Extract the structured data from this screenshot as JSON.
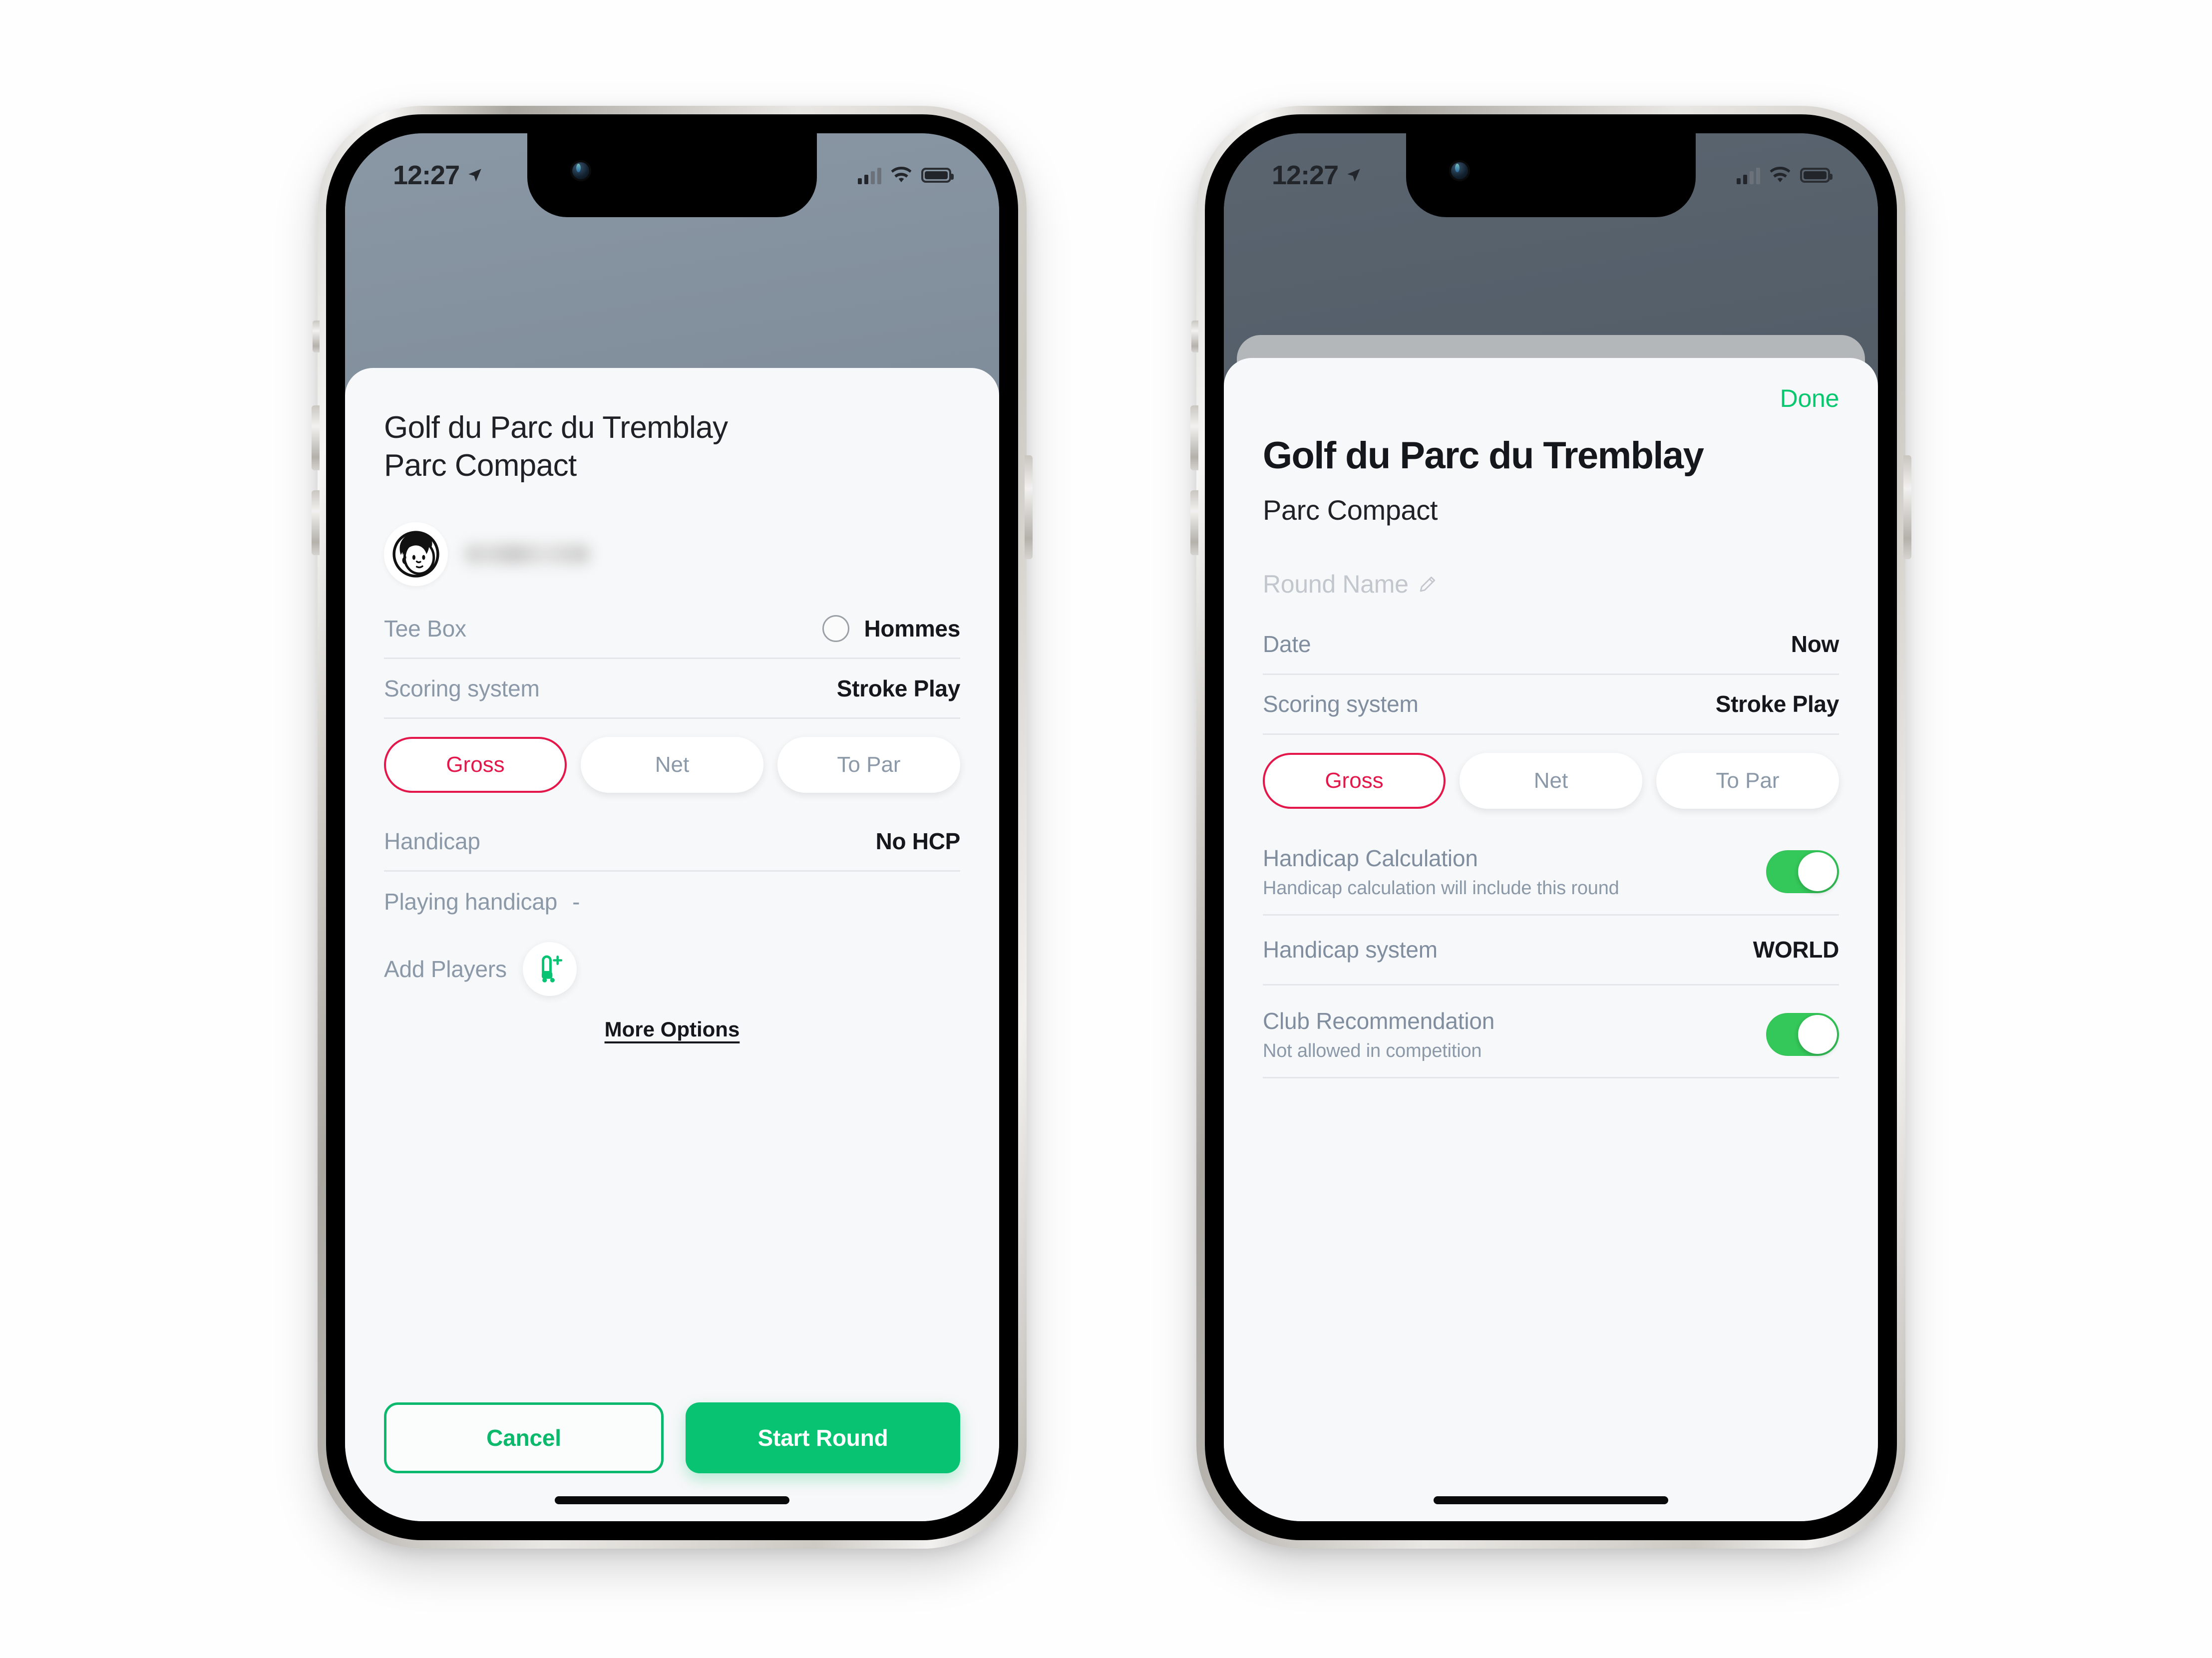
{
  "canvas": {
    "background": "#ffffff"
  },
  "theme": {
    "green": "#07c372",
    "green_link": "#07c86f",
    "toggle_green": "#34c759",
    "accent_red": "#e4174b",
    "label_gray": "#8b98a8",
    "value_dark": "#14181c",
    "sheet_bg": "#f7f8f9",
    "backdrop_left": "#7e8b99",
    "backdrop_right": "#515b66"
  },
  "status_bar": {
    "time": "12:27",
    "location_icon": "location-arrow-icon",
    "signal_icon": "cellular-signal-icon",
    "wifi_icon": "wifi-icon",
    "battery_icon": "battery-icon"
  },
  "left_phone": {
    "name": "start-round-sheet",
    "title": "Golf du Parc du Tremblay\nParc Compact",
    "title_line1": "Golf du Parc du Tremblay",
    "title_line2": "Parc Compact",
    "player": {
      "avatar_icon": "player-avatar-icon",
      "name_redacted": ""
    },
    "rows": [
      {
        "label": "Tee Box",
        "value": "Hommes",
        "has_swatch": true
      },
      {
        "label": "Scoring system",
        "value": "Stroke Play",
        "has_swatch": false
      }
    ],
    "segments": [
      {
        "label": "Gross",
        "active": true
      },
      {
        "label": "Net",
        "active": false
      },
      {
        "label": "To Par",
        "active": false
      }
    ],
    "handicap": {
      "label": "Handicap",
      "value": "No HCP"
    },
    "playing_handicap": {
      "label": "Playing handicap",
      "value": "-"
    },
    "add_players": {
      "label": "Add Players",
      "icon": "add-player-golf-bag-icon"
    },
    "more_options": "More Options",
    "actions": {
      "cancel": "Cancel",
      "start": "Start Round"
    }
  },
  "right_phone": {
    "name": "round-options-sheet",
    "done": "Done",
    "title": "Golf du Parc du Tremblay",
    "subtitle": "Parc Compact",
    "round_name": {
      "placeholder": "Round Name",
      "icon": "pencil-icon"
    },
    "rows": [
      {
        "label": "Date",
        "value": "Now"
      },
      {
        "label": "Scoring system",
        "value": "Stroke Play"
      }
    ],
    "segments": [
      {
        "label": "Gross",
        "active": true
      },
      {
        "label": "Net",
        "active": false
      },
      {
        "label": "To Par",
        "active": false
      }
    ],
    "toggles": [
      {
        "title": "Handicap Calculation",
        "subtitle": "Handicap calculation will include this round",
        "on": true
      },
      {
        "title": "Club Recommendation",
        "subtitle": "Not allowed in competition",
        "on": true
      }
    ],
    "handicap_system": {
      "label": "Handicap system",
      "value": "WORLD"
    }
  }
}
